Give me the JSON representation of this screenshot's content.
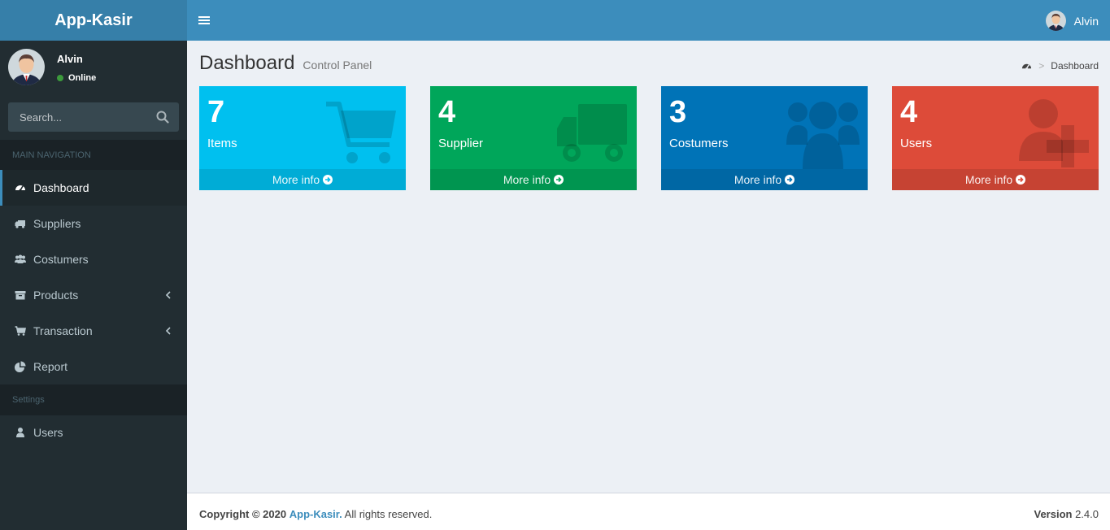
{
  "brand": {
    "title": "App-Kasir"
  },
  "user": {
    "name": "Alvin",
    "status": "Online"
  },
  "search": {
    "placeholder": "Search..."
  },
  "sidebar": {
    "header_main": "MAIN NAVIGATION",
    "header_settings": "Settings",
    "items": [
      {
        "label": "Dashboard",
        "icon": "dashboard-icon",
        "active": true
      },
      {
        "label": "Suppliers",
        "icon": "truck-icon"
      },
      {
        "label": "Costumers",
        "icon": "users-icon"
      },
      {
        "label": "Products",
        "icon": "archive-icon",
        "has_children": true
      },
      {
        "label": "Transaction",
        "icon": "cart-icon",
        "has_children": true
      },
      {
        "label": "Report",
        "icon": "pie-chart-icon"
      },
      {
        "label": "Users",
        "icon": "user-icon"
      }
    ]
  },
  "topbar": {
    "user_name": "Alvin"
  },
  "page": {
    "title": "Dashboard",
    "subtitle": "Control Panel"
  },
  "breadcrumb": {
    "current": "Dashboard"
  },
  "boxes": [
    {
      "value": "7",
      "label": "Items",
      "more": "More info",
      "color": "#00c0ef",
      "icon": "cart-icon"
    },
    {
      "value": "4",
      "label": "Supplier",
      "more": "More info",
      "color": "#00a65a",
      "icon": "truck-icon"
    },
    {
      "value": "3",
      "label": "Costumers",
      "more": "More info",
      "color": "#0073b7",
      "icon": "users-icon"
    },
    {
      "value": "4",
      "label": "Users",
      "more": "More info",
      "color": "#dd4b39",
      "icon": "user-plus-icon"
    }
  ],
  "footer": {
    "copyright": "Copyright © 2020",
    "brand": "App-Kasir.",
    "rights": "All rights reserved.",
    "version_label": "Version",
    "version": "2.4.0"
  }
}
